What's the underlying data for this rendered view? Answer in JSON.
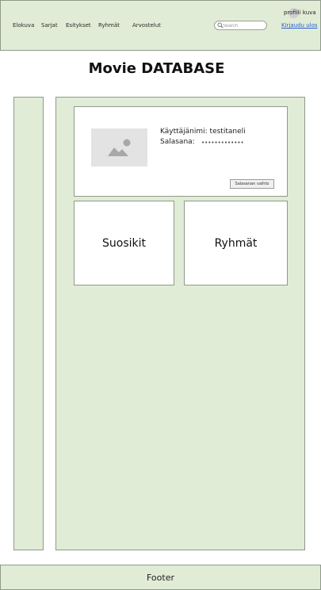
{
  "header": {
    "nav": [
      "Elokuva",
      "Sarjat",
      "Esitykset",
      "Ryhmät",
      "Arvostelut"
    ],
    "search_placeholder": "Search",
    "profile_label": "profiili kuva",
    "logout_label": "Kirjaudu ulos"
  },
  "page_title": "Movie DATABASE",
  "profile": {
    "username_line": "Käyttäjänimi: testitaneli",
    "password_label": "Salasana:",
    "password_mask": "•••••••••••••",
    "change_password_label": "Salasanan vaihto"
  },
  "tiles": {
    "favorites": "Suosikit",
    "groups": "Ryhmät"
  },
  "footer": {
    "label": "Footer"
  },
  "colors": {
    "panel": "#e1ecd7",
    "border": "#8f9a8a",
    "link": "#2a5fd1"
  }
}
